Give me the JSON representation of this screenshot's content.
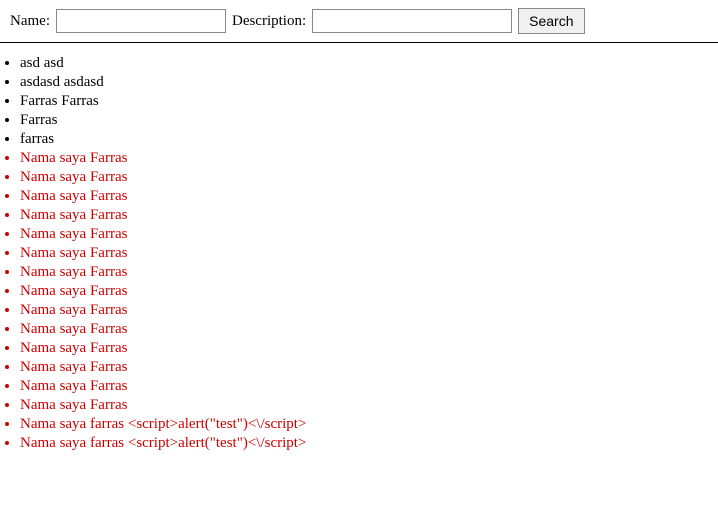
{
  "toolbar": {
    "name_label": "Name:",
    "name_placeholder": "",
    "description_label": "Description:",
    "description_placeholder": "",
    "search_button": "Search"
  },
  "results": [
    {
      "text": "asd asd",
      "color": "black"
    },
    {
      "text": "asdasd asdasd",
      "color": "black"
    },
    {
      "text": "Farras Farras",
      "color": "black"
    },
    {
      "text": "Farras",
      "color": "black"
    },
    {
      "text": "farras",
      "color": "black"
    },
    {
      "text": "Nama saya Farras",
      "color": "red"
    },
    {
      "text": "Nama saya Farras",
      "color": "red"
    },
    {
      "text": "Nama saya Farras",
      "color": "red"
    },
    {
      "text": "Nama saya Farras",
      "color": "red"
    },
    {
      "text": "Nama saya Farras",
      "color": "red"
    },
    {
      "text": "Nama saya Farras",
      "color": "red"
    },
    {
      "text": "Nama saya Farras",
      "color": "red"
    },
    {
      "text": "Nama saya Farras",
      "color": "red"
    },
    {
      "text": "Nama saya Farras",
      "color": "red"
    },
    {
      "text": "Nama saya Farras",
      "color": "red"
    },
    {
      "text": "Nama saya Farras",
      "color": "red"
    },
    {
      "text": "Nama saya Farras",
      "color": "red"
    },
    {
      "text": "Nama saya Farras",
      "color": "red"
    },
    {
      "text": "Nama saya Farras",
      "color": "red"
    },
    {
      "text": "Nama saya farras <script>alert(\"test\")<\\/script>",
      "color": "red"
    },
    {
      "text": "Nama saya farras <script>alert(\"test\")<\\/script>",
      "color": "red"
    }
  ]
}
